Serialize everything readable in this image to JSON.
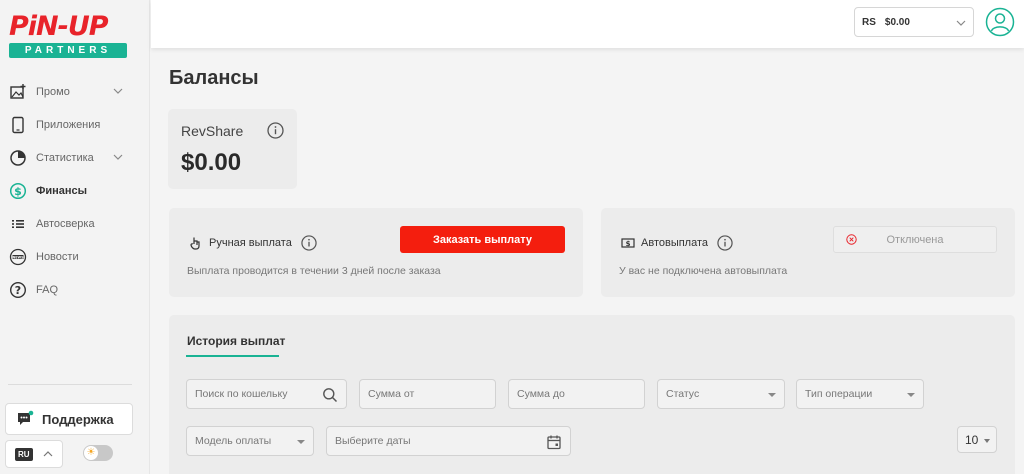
{
  "brand": {
    "logo_word": "PiN-UP",
    "logo_sub": "PARTNERS",
    "accent": "#1ab394",
    "brand_red": "#e8232a"
  },
  "sidebar": {
    "items": [
      {
        "label": "Промо",
        "icon": "image-add-icon",
        "expandable": true
      },
      {
        "label": "Приложения",
        "icon": "phone-icon",
        "expandable": false
      },
      {
        "label": "Статистика",
        "icon": "pie-chart-icon",
        "expandable": true
      },
      {
        "label": "Финансы",
        "icon": "dollar-circle-icon",
        "expandable": false,
        "active": true
      },
      {
        "label": "Автосверка",
        "icon": "list-icon",
        "expandable": false
      },
      {
        "label": "Новости",
        "icon": "news-icon",
        "expandable": false
      },
      {
        "label": "FAQ",
        "icon": "question-circle-icon",
        "expandable": false
      }
    ],
    "support_label": "Поддержка",
    "language": "RU"
  },
  "header": {
    "balance_currency": "RS",
    "balance_value": "$0.00"
  },
  "main": {
    "title": "Балансы",
    "revshare": {
      "label": "RevShare",
      "amount": "$0.00"
    },
    "manual_payout": {
      "title": "Ручная выплата",
      "button": "Заказать выплату",
      "description": "Выплата проводится в течении 3 дней после заказа"
    },
    "auto_payout": {
      "title": "Автовыплата",
      "status": "Отключена",
      "description": "У вас не подключена автовыплата"
    },
    "history": {
      "tab": "История выплат",
      "filters": {
        "wallet_search": "Поиск по кошельку",
        "amount_from": "Сумма от",
        "amount_to": "Сумма до",
        "status": "Статус",
        "operation_type": "Тип операции",
        "payment_model": "Модель оплаты",
        "dates": "Выберите даты"
      },
      "page_size": "10"
    }
  }
}
